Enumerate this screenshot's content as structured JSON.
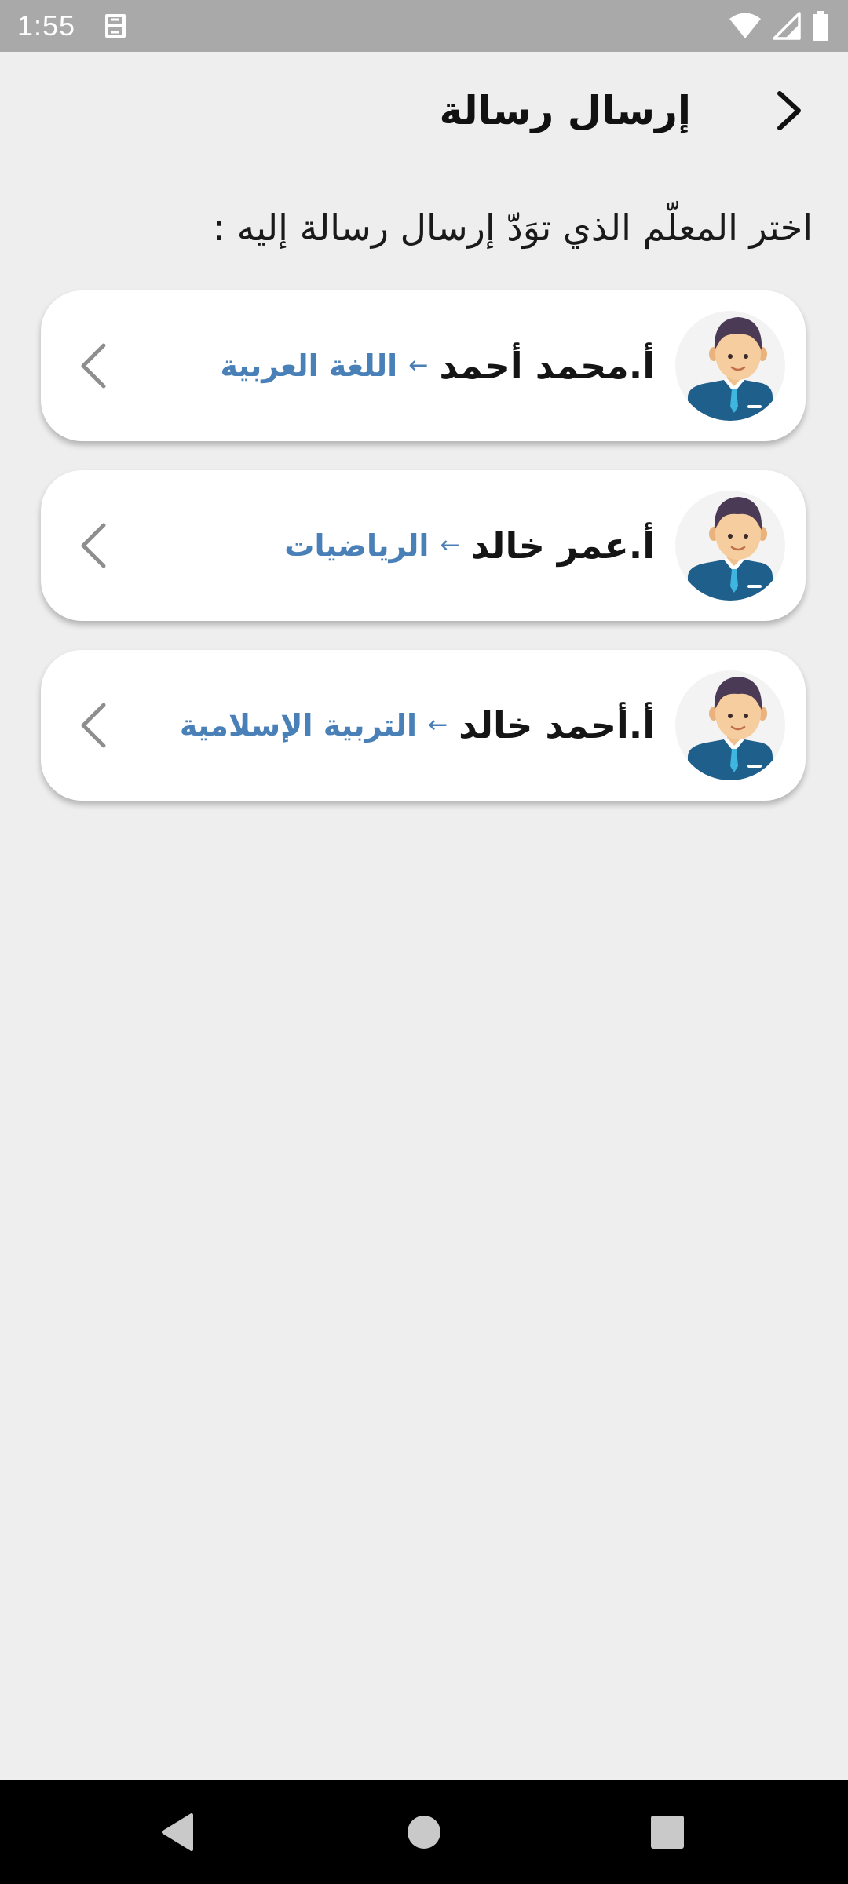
{
  "status_bar": {
    "time": "1:55",
    "icons": [
      "app-notification-icon",
      "wifi-icon",
      "cellular-signal-icon",
      "battery-icon"
    ]
  },
  "app_bar": {
    "title": "إرسال رسالة",
    "back_icon": "chevron-right-icon"
  },
  "instruction": "اختر المعلّم الذي توَدّ إرسال رسالة إليه :",
  "teachers": [
    {
      "name": "أ.محمد أحمد",
      "arrow": "←",
      "subject": "اللغة العربية"
    },
    {
      "name": "أ.عمر خالد",
      "arrow": "←",
      "subject": "الرياضيات"
    },
    {
      "name": "أ.أحمد خالد",
      "arrow": "←",
      "subject": "التربية الإسلامية"
    }
  ],
  "colors": {
    "background": "#eeeeee",
    "status_bar": "#a9a9a9",
    "subject_text": "#4a80b8",
    "card": "#ffffff",
    "nav_bar": "#000000"
  },
  "nav_bar": {
    "buttons": [
      "back-triangle-icon",
      "home-circle-icon",
      "recents-square-icon"
    ]
  }
}
